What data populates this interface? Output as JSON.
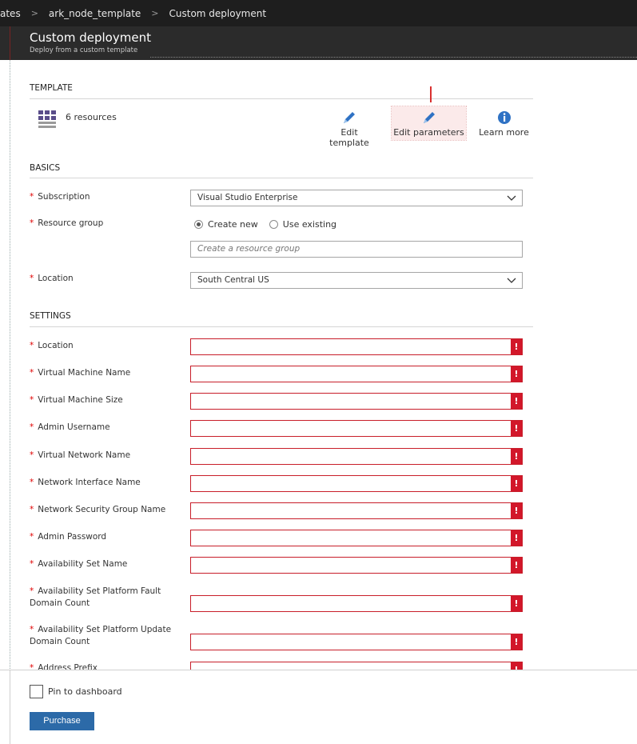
{
  "breadcrumb": [
    "ates",
    "ark_node_template",
    "Custom deployment"
  ],
  "blade": {
    "title": "Custom deployment",
    "subtitle": "Deploy from a custom template"
  },
  "template": {
    "section": "TEMPLATE",
    "resources_label": "6 resources",
    "tools": {
      "edit_template": "Edit template",
      "edit_parameters": "Edit parameters",
      "learn_more": "Learn more"
    }
  },
  "basics": {
    "section": "BASICS",
    "subscription_label": "Subscription",
    "subscription_value": "Visual Studio Enterprise",
    "resource_group_label": "Resource group",
    "create_new": "Create new",
    "use_existing": "Use existing",
    "resource_group_placeholder": "Create a resource group",
    "location_label": "Location",
    "location_value": "South Central US"
  },
  "settings": {
    "section": "SETTINGS",
    "fields": [
      "Location",
      "Virtual Machine Name",
      "Virtual Machine Size",
      "Admin Username",
      "Virtual Network Name",
      "Network Interface Name",
      "Network Security Group Name",
      "Admin Password",
      "Availability Set Name",
      "Availability Set Platform Fault Domain Count",
      "Availability Set Platform Update Domain Count",
      "Address Prefix"
    ],
    "error_glyph": "!"
  },
  "footer": {
    "pin_label": "Pin to dashboard",
    "purchase_label": "Purchase"
  },
  "colors": {
    "accent": "#2c6aa8",
    "error": "#d2172a",
    "required": "#e00000"
  }
}
